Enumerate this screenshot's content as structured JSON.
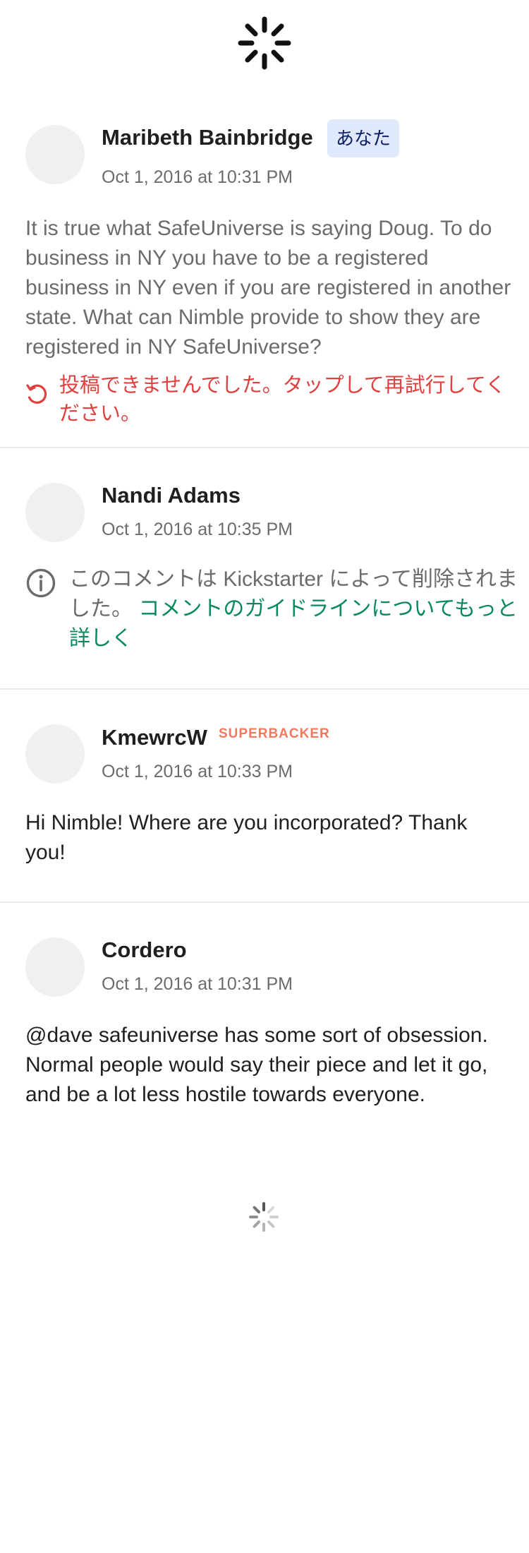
{
  "loading": {
    "top_spinner_icon": "spinner-icon",
    "bottom_spinner_icon": "spinner-icon"
  },
  "colors": {
    "superbacker": "#f1785d",
    "error": "#e0403f",
    "link": "#0a8a5a",
    "badge_bg": "#e0e8fb",
    "muted_text": "#6b6b6b"
  },
  "comments": [
    {
      "author": "Maribeth Bainbridge",
      "badge": "あなた",
      "timestamp": "Oct 1, 2016 at 10:31 PM",
      "body": "It is true what SafeUniverse is saying Doug. To do business in NY you have to be a registered business in NY even if you are registered in another state. What can Nimble provide to show they are registered in NY SafeUniverse?",
      "error_icon": "retry-icon",
      "error_text": "投稿できませんでした。タップして再試行してください。"
    },
    {
      "author": "Nandi Adams",
      "timestamp": "Oct 1, 2016 at 10:35 PM",
      "info_icon": "info-icon",
      "removed_text": "このコメントは Kickstarter によって削除されました。",
      "guidelines_link": "コメントのガイドラインについてもっと詳しく"
    },
    {
      "author": "KmewrcW",
      "badge": "SUPERBACKER",
      "timestamp": "Oct 1, 2016 at 10:33 PM",
      "body": "Hi Nimble! Where are you incorporated? Thank you!"
    },
    {
      "author": "Cordero",
      "timestamp": "Oct 1, 2016 at 10:31 PM",
      "body": "@dave safeuniverse has some sort of obsession. Normal people would say their piece and let it go, and be a lot less hostile towards everyone."
    }
  ]
}
